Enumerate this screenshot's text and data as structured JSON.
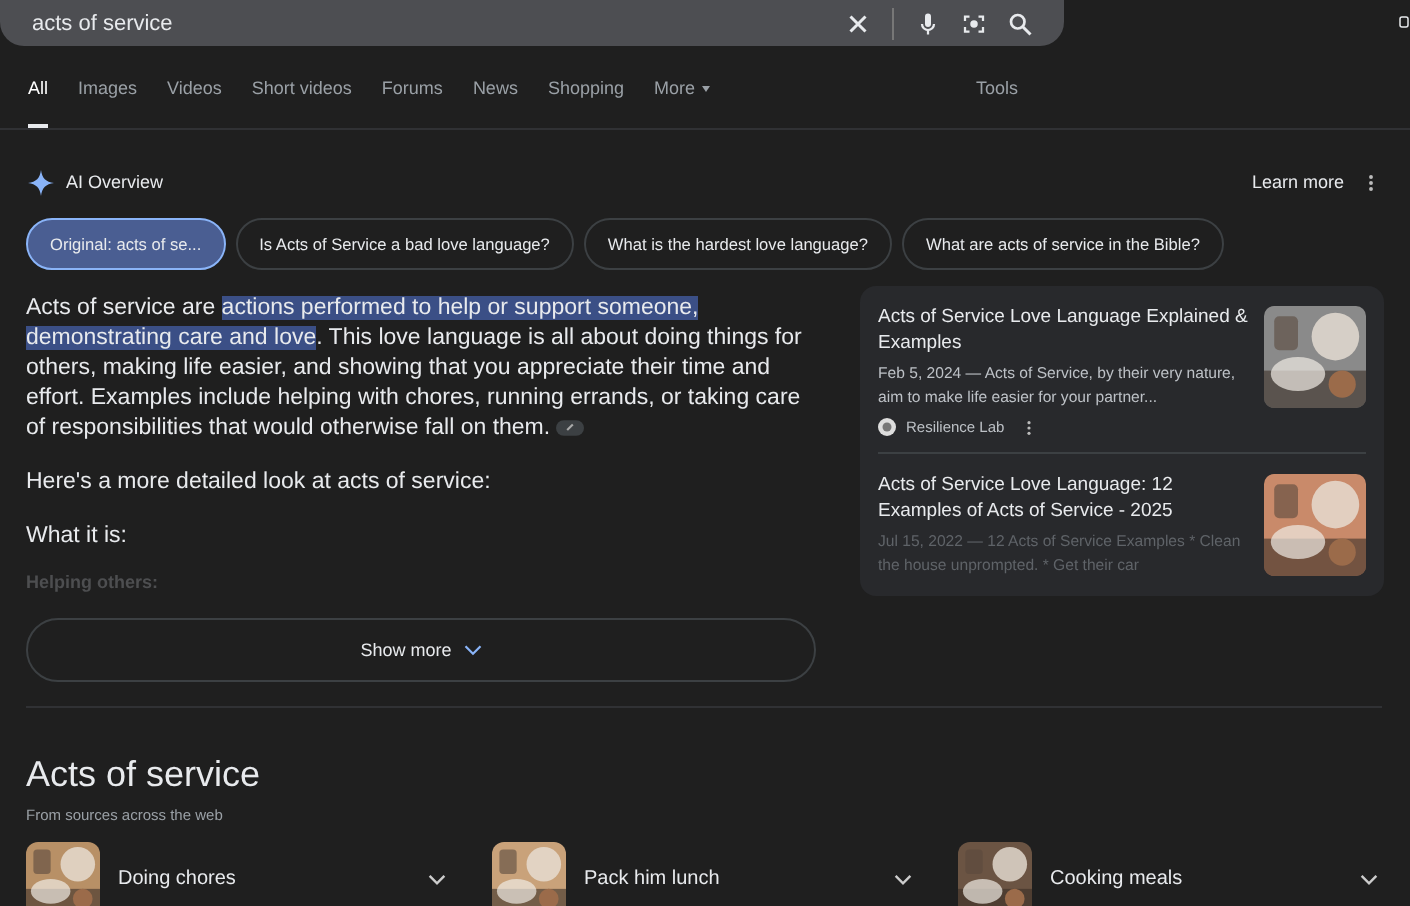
{
  "search": {
    "value": "acts of service"
  },
  "tabs": [
    {
      "label": "All",
      "selected": true
    },
    {
      "label": "Images",
      "selected": false
    },
    {
      "label": "Videos",
      "selected": false
    },
    {
      "label": "Short videos",
      "selected": false
    },
    {
      "label": "Forums",
      "selected": false
    },
    {
      "label": "News",
      "selected": false
    },
    {
      "label": "Shopping",
      "selected": false
    },
    {
      "label": "More",
      "selected": false,
      "kind": "menu"
    }
  ],
  "tools": "Tools",
  "ai_overview": {
    "title": "AI Overview",
    "learn_more": "Learn more",
    "chips": [
      {
        "label": "Original: acts of se...",
        "selected": true
      },
      {
        "label": "Is Acts of Service a bad love language?",
        "selected": false
      },
      {
        "label": "What is the hardest love language?",
        "selected": false
      },
      {
        "label": "What are acts of service in the Bible?",
        "selected": false
      }
    ],
    "answer": {
      "lead": "Acts of service are ",
      "highlight": "actions performed to help or support someone, demonstrating care and love",
      "rest": ". This love language is all about doing things for others, making life easier, and showing that you appreciate their time and effort. Examples include helping with chores, running errands, or taking care of responsibilities that would otherwise fall on them."
    },
    "detail_intro": "Here's a more detailed look at acts of service:",
    "heading": "What it is:",
    "faded_heading": "Helping others:",
    "show_more": "Show more",
    "sources": [
      {
        "title": "Acts of Service Love Language Explained & Examples",
        "snippet": "Feb 5, 2024 — Acts of Service, by their very nature, aim to make life easier for your partner...",
        "site": "Resilience Lab",
        "faded": false
      },
      {
        "title": "Acts of Service Love Language: 12 Examples of Acts of Service - 2025",
        "snippet": "Jul 15, 2022 — 12 Acts of Service Examples * Clean the house unprompted. * Get their car",
        "faded": true
      }
    ]
  },
  "section": {
    "title": "Acts of service",
    "subtitle": "From sources across the web",
    "items": [
      {
        "label": "Doing chores"
      },
      {
        "label": "Pack him lunch"
      },
      {
        "label": "Cooking meals"
      }
    ]
  }
}
